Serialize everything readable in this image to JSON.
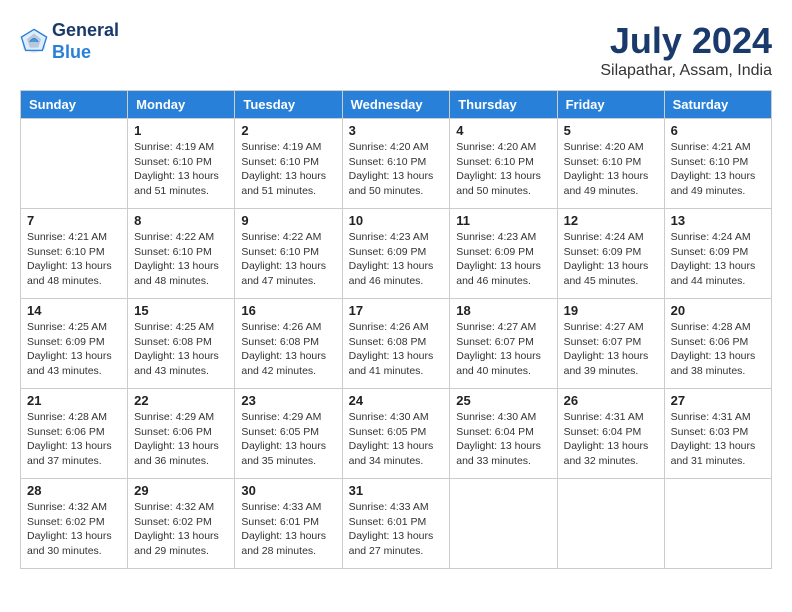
{
  "header": {
    "logo_line1": "General",
    "logo_line2": "Blue",
    "month": "July 2024",
    "location": "Silapathar, Assam, India"
  },
  "weekdays": [
    "Sunday",
    "Monday",
    "Tuesday",
    "Wednesday",
    "Thursday",
    "Friday",
    "Saturday"
  ],
  "weeks": [
    [
      {
        "day": "",
        "info": ""
      },
      {
        "day": "1",
        "info": "Sunrise: 4:19 AM\nSunset: 6:10 PM\nDaylight: 13 hours\nand 51 minutes."
      },
      {
        "day": "2",
        "info": "Sunrise: 4:19 AM\nSunset: 6:10 PM\nDaylight: 13 hours\nand 51 minutes."
      },
      {
        "day": "3",
        "info": "Sunrise: 4:20 AM\nSunset: 6:10 PM\nDaylight: 13 hours\nand 50 minutes."
      },
      {
        "day": "4",
        "info": "Sunrise: 4:20 AM\nSunset: 6:10 PM\nDaylight: 13 hours\nand 50 minutes."
      },
      {
        "day": "5",
        "info": "Sunrise: 4:20 AM\nSunset: 6:10 PM\nDaylight: 13 hours\nand 49 minutes."
      },
      {
        "day": "6",
        "info": "Sunrise: 4:21 AM\nSunset: 6:10 PM\nDaylight: 13 hours\nand 49 minutes."
      }
    ],
    [
      {
        "day": "7",
        "info": "Sunrise: 4:21 AM\nSunset: 6:10 PM\nDaylight: 13 hours\nand 48 minutes."
      },
      {
        "day": "8",
        "info": "Sunrise: 4:22 AM\nSunset: 6:10 PM\nDaylight: 13 hours\nand 48 minutes."
      },
      {
        "day": "9",
        "info": "Sunrise: 4:22 AM\nSunset: 6:10 PM\nDaylight: 13 hours\nand 47 minutes."
      },
      {
        "day": "10",
        "info": "Sunrise: 4:23 AM\nSunset: 6:09 PM\nDaylight: 13 hours\nand 46 minutes."
      },
      {
        "day": "11",
        "info": "Sunrise: 4:23 AM\nSunset: 6:09 PM\nDaylight: 13 hours\nand 46 minutes."
      },
      {
        "day": "12",
        "info": "Sunrise: 4:24 AM\nSunset: 6:09 PM\nDaylight: 13 hours\nand 45 minutes."
      },
      {
        "day": "13",
        "info": "Sunrise: 4:24 AM\nSunset: 6:09 PM\nDaylight: 13 hours\nand 44 minutes."
      }
    ],
    [
      {
        "day": "14",
        "info": "Sunrise: 4:25 AM\nSunset: 6:09 PM\nDaylight: 13 hours\nand 43 minutes."
      },
      {
        "day": "15",
        "info": "Sunrise: 4:25 AM\nSunset: 6:08 PM\nDaylight: 13 hours\nand 43 minutes."
      },
      {
        "day": "16",
        "info": "Sunrise: 4:26 AM\nSunset: 6:08 PM\nDaylight: 13 hours\nand 42 minutes."
      },
      {
        "day": "17",
        "info": "Sunrise: 4:26 AM\nSunset: 6:08 PM\nDaylight: 13 hours\nand 41 minutes."
      },
      {
        "day": "18",
        "info": "Sunrise: 4:27 AM\nSunset: 6:07 PM\nDaylight: 13 hours\nand 40 minutes."
      },
      {
        "day": "19",
        "info": "Sunrise: 4:27 AM\nSunset: 6:07 PM\nDaylight: 13 hours\nand 39 minutes."
      },
      {
        "day": "20",
        "info": "Sunrise: 4:28 AM\nSunset: 6:06 PM\nDaylight: 13 hours\nand 38 minutes."
      }
    ],
    [
      {
        "day": "21",
        "info": "Sunrise: 4:28 AM\nSunset: 6:06 PM\nDaylight: 13 hours\nand 37 minutes."
      },
      {
        "day": "22",
        "info": "Sunrise: 4:29 AM\nSunset: 6:06 PM\nDaylight: 13 hours\nand 36 minutes."
      },
      {
        "day": "23",
        "info": "Sunrise: 4:29 AM\nSunset: 6:05 PM\nDaylight: 13 hours\nand 35 minutes."
      },
      {
        "day": "24",
        "info": "Sunrise: 4:30 AM\nSunset: 6:05 PM\nDaylight: 13 hours\nand 34 minutes."
      },
      {
        "day": "25",
        "info": "Sunrise: 4:30 AM\nSunset: 6:04 PM\nDaylight: 13 hours\nand 33 minutes."
      },
      {
        "day": "26",
        "info": "Sunrise: 4:31 AM\nSunset: 6:04 PM\nDaylight: 13 hours\nand 32 minutes."
      },
      {
        "day": "27",
        "info": "Sunrise: 4:31 AM\nSunset: 6:03 PM\nDaylight: 13 hours\nand 31 minutes."
      }
    ],
    [
      {
        "day": "28",
        "info": "Sunrise: 4:32 AM\nSunset: 6:02 PM\nDaylight: 13 hours\nand 30 minutes."
      },
      {
        "day": "29",
        "info": "Sunrise: 4:32 AM\nSunset: 6:02 PM\nDaylight: 13 hours\nand 29 minutes."
      },
      {
        "day": "30",
        "info": "Sunrise: 4:33 AM\nSunset: 6:01 PM\nDaylight: 13 hours\nand 28 minutes."
      },
      {
        "day": "31",
        "info": "Sunrise: 4:33 AM\nSunset: 6:01 PM\nDaylight: 13 hours\nand 27 minutes."
      },
      {
        "day": "",
        "info": ""
      },
      {
        "day": "",
        "info": ""
      },
      {
        "day": "",
        "info": ""
      }
    ]
  ]
}
